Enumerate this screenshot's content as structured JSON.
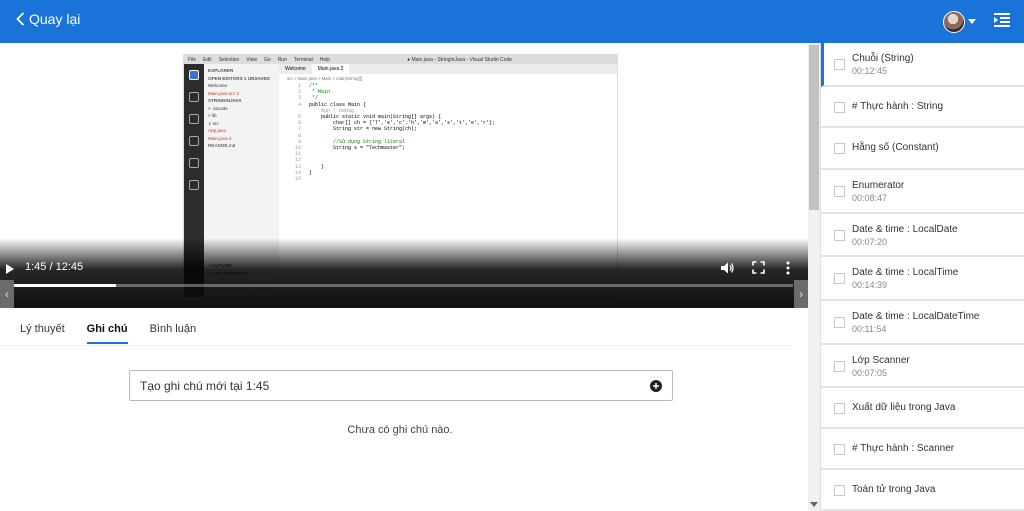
{
  "header": {
    "back_label": "Quay lại",
    "colors": {
      "bar": "#1a73d9"
    }
  },
  "video": {
    "current_time": "1:45",
    "duration": "12:45",
    "time_display": "1:45 / 12:45",
    "progress_fraction": 0.137,
    "ide": {
      "title": "● Main.java - StringInJava - Visual Studio Code",
      "menu": [
        "File",
        "Edit",
        "Selection",
        "View",
        "Go",
        "Run",
        "Terminal",
        "Help"
      ],
      "tabs": [
        "Welcome",
        "Main.java 2"
      ],
      "breadcrumb": "src > Main.java > Main > main(String[])",
      "explorer": [
        "EXPLORER",
        "OPEN EDITORS  1 UNSAVED",
        "Welcome",
        "Main.java  src  2",
        "STRINGINJAVA",
        "> .vscode",
        "> lib",
        "∨ src",
        "App.java",
        "Main.java  2",
        "README.md",
        "",
        "",
        "",
        "",
        "",
        "",
        "",
        "",
        "",
        "",
        "",
        "",
        "",
        "",
        "",
        "> OUTLINE",
        "> JAVA PROJECTS"
      ],
      "code": [
        [
          "1",
          "/**"
        ],
        [
          "2",
          " * Main"
        ],
        [
          "3",
          " */"
        ],
        [
          "4",
          "public class Main {"
        ],
        [
          "",
          "    Run | Debug"
        ],
        [
          "5",
          "    public static void main(String[] args) {"
        ],
        [
          "6",
          "        char[] ch = {'T','e','c','h','m','a','s','t','e','r'};"
        ],
        [
          "7",
          "        String str = new String(ch);"
        ],
        [
          "8",
          ""
        ],
        [
          "9",
          "        //Sử dụng String literal"
        ],
        [
          "10",
          "        String s = \"Techmaster\";"
        ],
        [
          "11",
          ""
        ],
        [
          "12",
          ""
        ],
        [
          "13",
          "    }"
        ],
        [
          "14",
          "}"
        ],
        [
          "15",
          ""
        ]
      ]
    }
  },
  "tabs": [
    "Lý thuyết",
    "Ghi chú",
    "Bình luận"
  ],
  "active_tab": "Ghi chú",
  "note": {
    "placeholder": "Tạo ghi chú mới tại 1:45",
    "empty_message": "Chưa có ghi chú nào."
  },
  "lessons": [
    {
      "title": "Chuỗi (String)",
      "duration": "00:12:45",
      "current": true
    },
    {
      "title": "# Thực hành : String",
      "duration": ""
    },
    {
      "title": "Hằng số (Constant)",
      "duration": ""
    },
    {
      "title": "Enumerator",
      "duration": "00:08:47"
    },
    {
      "title": "Date & time : LocalDate",
      "duration": "00:07:20"
    },
    {
      "title": "Date & time : LocalTime",
      "duration": "00:14:39"
    },
    {
      "title": "Date & time : LocalDateTime",
      "duration": "00:11:54"
    },
    {
      "title": "Lớp Scanner",
      "duration": "00:07:05"
    },
    {
      "title": "Xuất dữ liệu trong Java",
      "duration": ""
    },
    {
      "title": "# Thực hành : Scanner",
      "duration": ""
    },
    {
      "title": "Toán tử trong Java",
      "duration": ""
    }
  ]
}
